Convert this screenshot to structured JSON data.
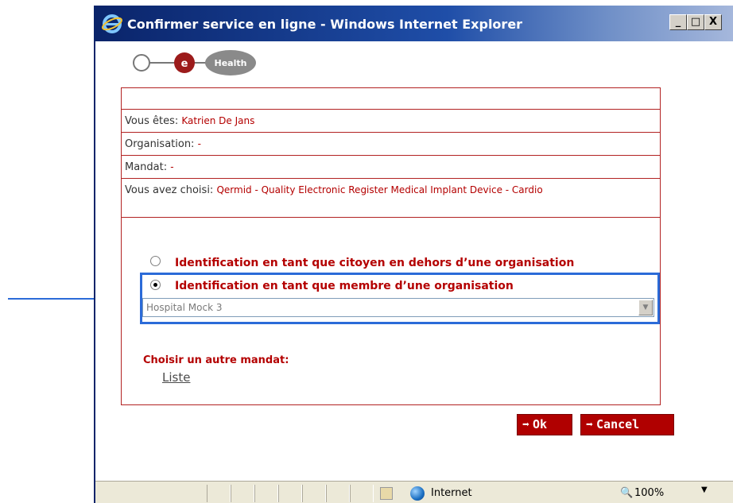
{
  "window": {
    "title": "Confirmer service en ligne - Windows Internet Explorer",
    "controls": {
      "minimize": "_",
      "maximize": "□",
      "close": "X"
    }
  },
  "logo": {
    "letter": "e",
    "word": "Health"
  },
  "info": {
    "user_label": "Vous êtes:",
    "user_value": "Katrien De Jans",
    "org_label": "Organisation:",
    "org_value": "-",
    "mandate_label": "Mandat:",
    "mandate_value": "-",
    "choice_label": "Vous avez choisi:",
    "choice_value": "Qermid - Quality Electronic Register Medical Implant Device - Cardio"
  },
  "options": {
    "citizen_label": "Identification en tant que citoyen en dehors d’une organisation",
    "member_label": "Identification en tant que membre d’une organisation",
    "selected": "member",
    "organisation_select_value": "Hospital Mock 3"
  },
  "mandate": {
    "heading": "Choisir un autre mandat:",
    "list_link": "Liste"
  },
  "buttons": {
    "ok": "Ok",
    "cancel": "Cancel",
    "arrow": "➡"
  },
  "statusbar": {
    "zone": "Internet",
    "zoom": "100%"
  },
  "colors": {
    "accent_red": "#b40000",
    "highlight_blue": "#2b6bd8",
    "titlebar": "#0a246a"
  }
}
